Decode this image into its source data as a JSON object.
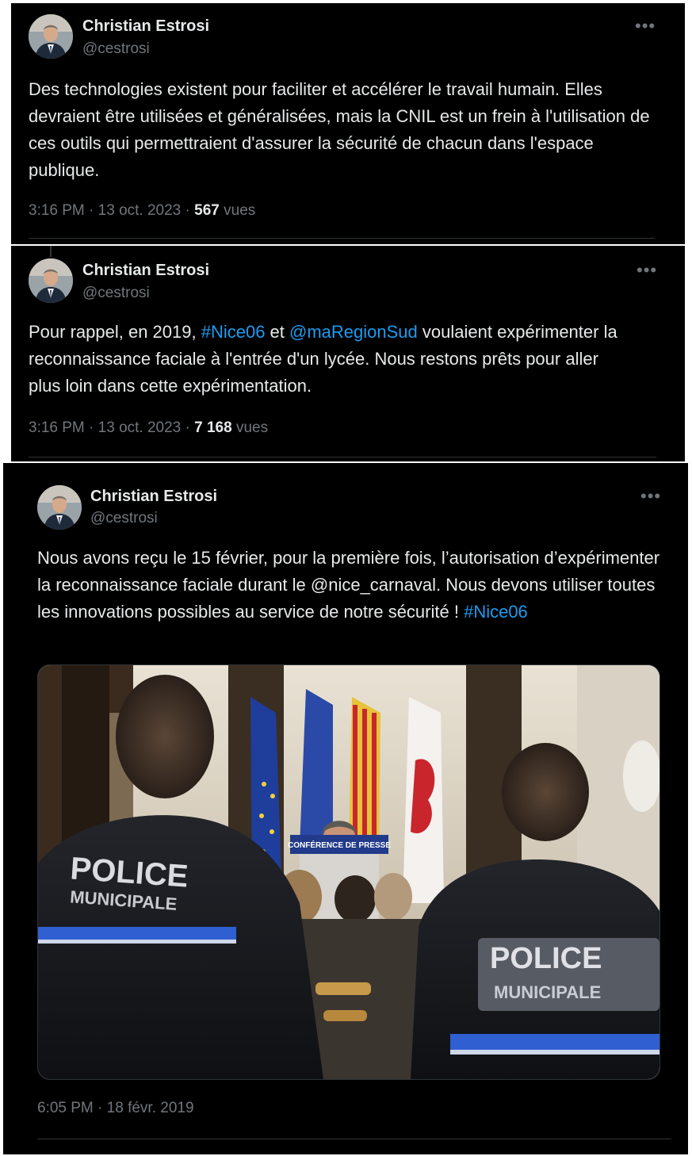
{
  "tweets": [
    {
      "author": {
        "name": "Christian Estrosi",
        "handle": "@cestrosi"
      },
      "more_icon": "more-horizontal-icon",
      "text": "Des technologies existent pour faciliter et accélérer le travail humain. Elles devraient être utilisées et généralisées, mais la CNIL est un frein à l'utilisation de ces outils qui permettraient d'assurer la sécurité de chacun dans l'espace publique.",
      "time": "3:16 PM",
      "date": "13 oct. 2023",
      "views": "567",
      "views_label": "vues"
    },
    {
      "author": {
        "name": "Christian Estrosi",
        "handle": "@cestrosi"
      },
      "more_icon": "more-horizontal-icon",
      "text_parts": {
        "before": "Pour rappel, en 2019, ",
        "hashtag": "#Nice06",
        "middle": " et ",
        "mention": "@maRegionSud",
        "after": " voulaient expérimenter la reconnaissance faciale à l'entrée d'un lycée. Nous restons prêts pour aller plus loin dans cette expérimentation."
      },
      "time": "3:16 PM",
      "date": "13 oct. 2023",
      "views": "7 168",
      "views_label": "vues"
    },
    {
      "author": {
        "name": "Christian Estrosi",
        "handle": "@cestrosi"
      },
      "more_icon": "more-horizontal-icon",
      "text_parts": {
        "before": "Nous avons reçu le 15 février, pour la première fois, l’autorisation d’expérimenter la reconnaissance faciale durant le @nice_carnaval. Nous devons utiliser toutes les innovations possibles au service de notre sécurité ! ",
        "hashtag": "#Nice06"
      },
      "media": {
        "podium_sign": "CONFÉRENCE DE PRESSE",
        "jacket_text_left": [
          "POLICE",
          "MUNICIPALE"
        ],
        "jacket_text_right": [
          "POLICE",
          "MUNICIPALE"
        ]
      },
      "time": "6:05 PM",
      "date": "18 févr. 2019"
    }
  ],
  "separator": "·",
  "colors": {
    "background": "#000000",
    "text": "#e7e9ea",
    "secondary": "#71767b",
    "link": "#1d9bf0",
    "divider": "#2f3336"
  }
}
